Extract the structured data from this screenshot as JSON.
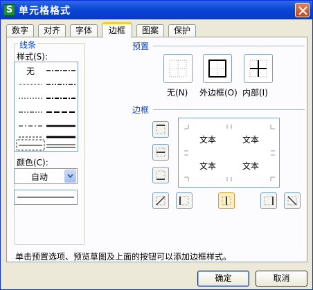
{
  "window": {
    "title": "单元格格式",
    "icon_letter": "S"
  },
  "tabs": [
    "数字",
    "对齐",
    "字体",
    "边框",
    "图案",
    "保护"
  ],
  "active_tab": "边框",
  "line": {
    "group_label": "线条",
    "style_label": "样式(S):",
    "none_style": "无",
    "color_label": "颜色(C):",
    "color_value": "自动"
  },
  "presets": {
    "group_label": "预置",
    "items": [
      "无(N)",
      "外边框(O)",
      "内部(I)"
    ]
  },
  "border": {
    "group_label": "边框",
    "preview_texts": [
      "文本",
      "文本",
      "文本",
      "文本"
    ]
  },
  "hint": "单击预置选项、预览草图及上面的按钮可以添加边框样式。",
  "buttons": {
    "ok": "确定",
    "cancel": "取消"
  }
}
